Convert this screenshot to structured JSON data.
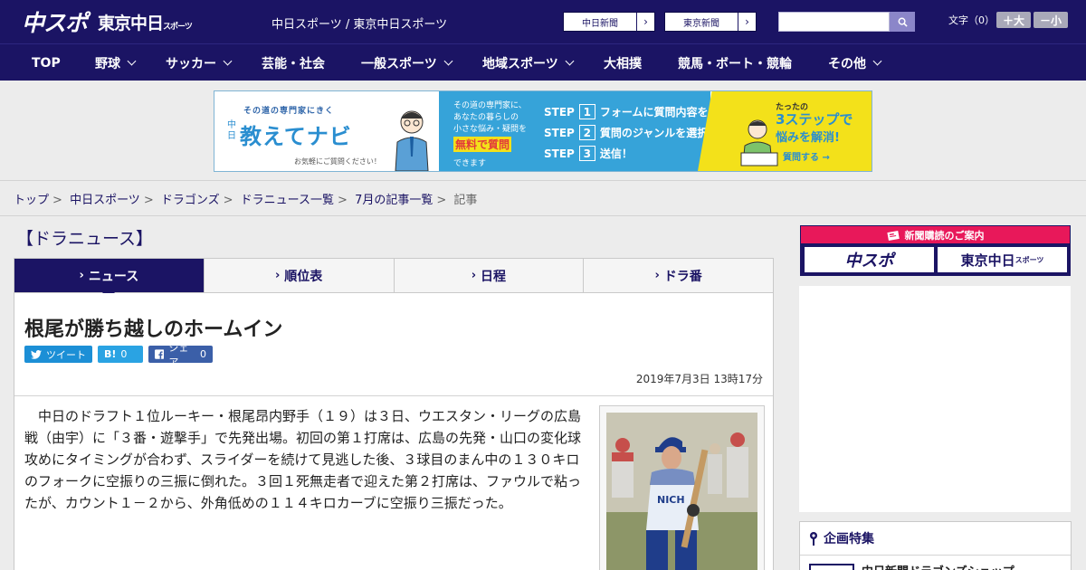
{
  "header": {
    "logo_main": "中スポ",
    "logo_sub": "東京中日",
    "logo_sub_small": "スポーツ",
    "tagline": "中日スポーツ / 東京中日スポーツ",
    "links": [
      {
        "label": "中日新聞"
      },
      {
        "label": "東京新聞"
      }
    ],
    "search": {
      "value": "",
      "placeholder": ""
    },
    "font_size_label": "文字（0）",
    "font_up": "＋大",
    "font_down": "－小"
  },
  "nav": {
    "items": [
      {
        "label": "TOP",
        "has_menu": false
      },
      {
        "label": "野球",
        "has_menu": true
      },
      {
        "label": "サッカー",
        "has_menu": true
      },
      {
        "label": "芸能・社会",
        "has_menu": false
      },
      {
        "label": "一般スポーツ",
        "has_menu": true
      },
      {
        "label": "地域スポーツ",
        "has_menu": true
      },
      {
        "label": "大相撲",
        "has_menu": false
      },
      {
        "label": "競馬・ボート・競輪",
        "has_menu": false
      },
      {
        "label": "その他",
        "has_menu": true
      }
    ]
  },
  "banner": {
    "tag": "その道の専門家にきく",
    "side": "中日",
    "title": "教えてナビ",
    "note": "お気軽にご質問ください！",
    "desc_lines": [
      "その道の専門家に、",
      "あなたの暮らしの",
      "小さな悩み・疑問を"
    ],
    "free": "無料で質問",
    "can": "できます",
    "steps": [
      {
        "label": "STEP",
        "num": "1",
        "text": "フォームに質問内容を入力"
      },
      {
        "label": "STEP",
        "num": "2",
        "text": "質問のジャンルを選択"
      },
      {
        "label": "STEP",
        "num": "3",
        "text": "送信！"
      }
    ],
    "three_top": "たったの",
    "three": "3ステップで",
    "three_sub": "悩みを解消!",
    "ask": "質問する →"
  },
  "breadcrumb": {
    "items": [
      "トップ",
      "中日スポーツ",
      "ドラゴンズ",
      "ドラニュース一覧",
      "7月の記事一覧"
    ],
    "current": "記事"
  },
  "main": {
    "section_title": "【ドラニュース】",
    "tabs": [
      {
        "label": "ニュース",
        "active": true
      },
      {
        "label": "順位表",
        "active": false
      },
      {
        "label": "日程",
        "active": false
      },
      {
        "label": "ドラ番",
        "active": false
      }
    ],
    "article": {
      "headline": "根尾が勝ち越しのホームイン",
      "share": {
        "tweet": "ツイート",
        "hatena_icon": "B!",
        "hatena_count": "0",
        "fb_label": "シェア",
        "fb_count": "0"
      },
      "date": "2019年7月3日 13時17分",
      "body": "中日のドラフト１位ルーキー・根尾昂内野手（１９）は３日、ウエスタン・リーグの広島戦（由宇）に「３番・遊撃手」で先発出場。初回の第１打席は、広島の先発・山口の変化球攻めにタイミングが合わず、スライダーを続けて見逃した後、３球目のまん中の１３０キロのフォークに空振りの三振に倒れた。３回１死無走者で迎えた第２打席は、ファウルで粘ったが、カウント１－２から、外角低めの１１４キロカーブに空振り三振だった。"
    }
  },
  "sidebar": {
    "subscribe_head": "新聞購読のご案内",
    "logo1": "中スポ",
    "logo2": "東京中日",
    "logo2_small": "スポーツ",
    "feature_title": "企画特集",
    "feature_item": "中日新聞ドラゴンズショップ"
  },
  "colors": {
    "brand": "#1b1464",
    "accent_pink": "#e8185a",
    "twitter": "#1c8fd6",
    "facebook": "#3b5fa8"
  }
}
